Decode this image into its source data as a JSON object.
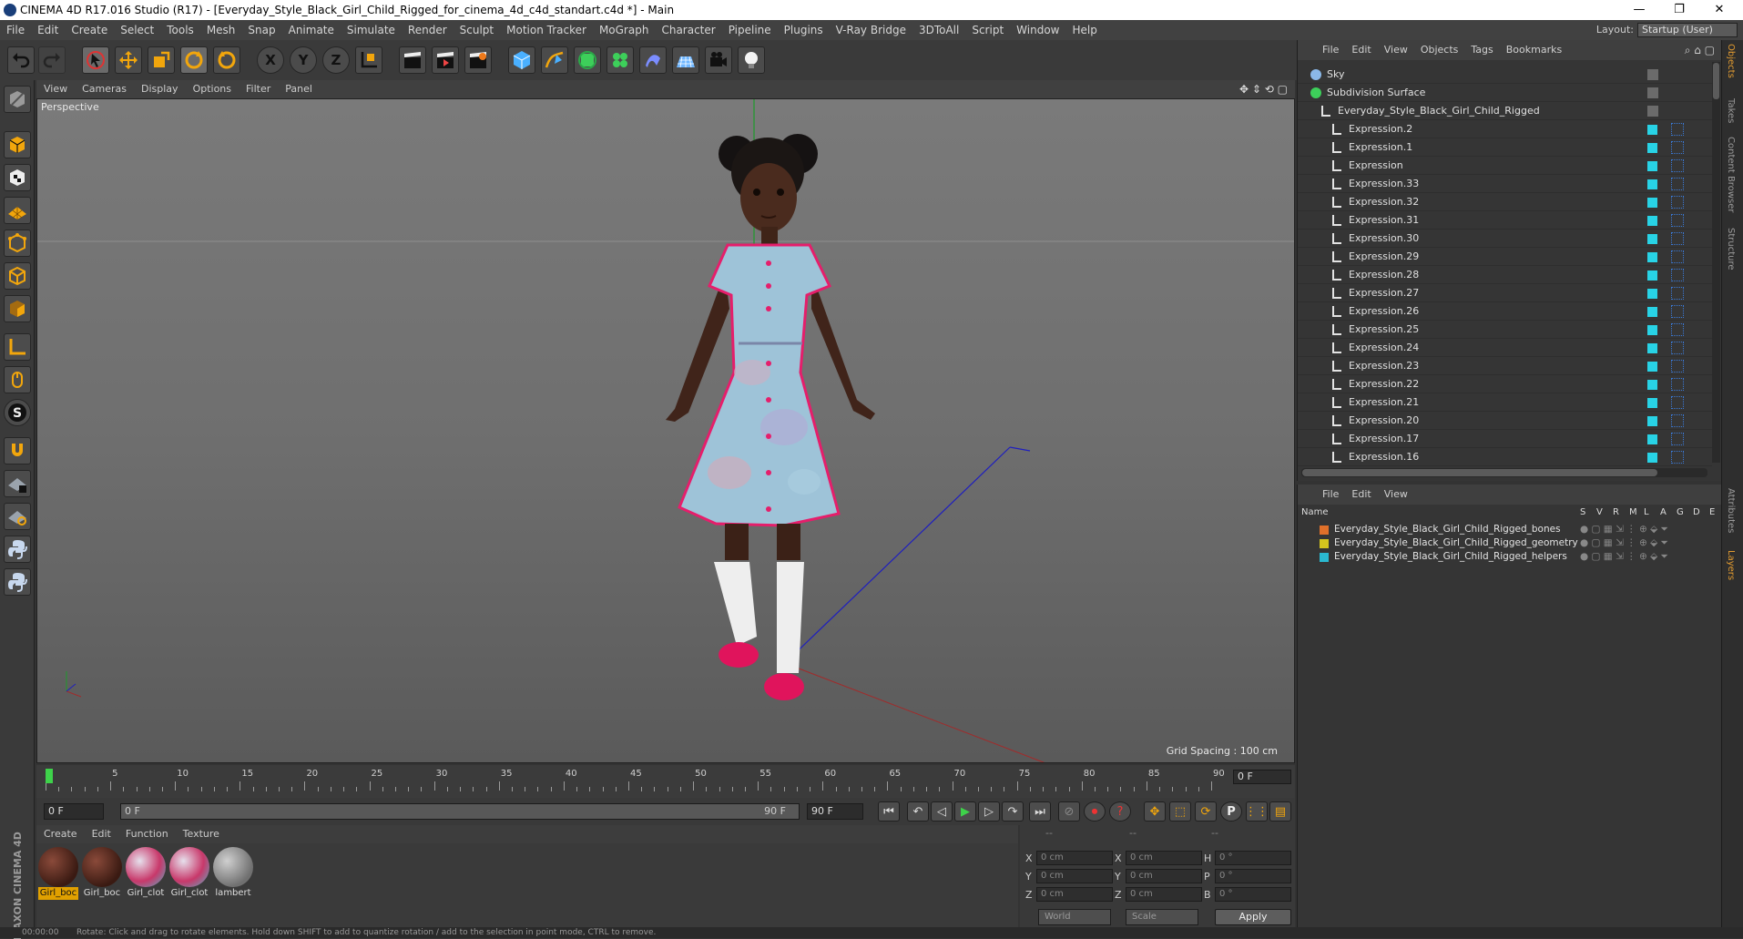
{
  "window": {
    "title": "CINEMA 4D R17.016 Studio (R17) - [Everyday_Style_Black_Girl_Child_Rigged_for_cinema_4d_c4d_standart.c4d *] - Main",
    "minimize": "—",
    "maximize": "❐",
    "close": "✕"
  },
  "menubar": {
    "items": [
      "File",
      "Edit",
      "Create",
      "Select",
      "Tools",
      "Mesh",
      "Snap",
      "Animate",
      "Simulate",
      "Render",
      "Sculpt",
      "Motion Tracker",
      "MoGraph",
      "Character",
      "Pipeline",
      "Plugins",
      "V-Ray Bridge",
      "3DToAll",
      "Script",
      "Window",
      "Help"
    ],
    "layout_label": "Layout:",
    "layout_value": "Startup (User)"
  },
  "toolbar": {
    "x_label": "X",
    "y_label": "Y",
    "z_label": "Z"
  },
  "viewport": {
    "menu": [
      "View",
      "Cameras",
      "Display",
      "Options",
      "Filter",
      "Panel"
    ],
    "label": "Perspective",
    "grid_spacing": "Grid Spacing : 100 cm"
  },
  "timeline": {
    "ticks": [
      "0",
      "5",
      "10",
      "15",
      "20",
      "25",
      "30",
      "35",
      "40",
      "45",
      "50",
      "55",
      "60",
      "65",
      "70",
      "75",
      "80",
      "85",
      "90"
    ],
    "current_frame": "0 F",
    "start_frame": "0 F",
    "range_start": "0 F",
    "range_end": "90 F",
    "end_frame": "90 F"
  },
  "materials": {
    "menu": [
      "Create",
      "Edit",
      "Function",
      "Texture"
    ],
    "items": [
      {
        "label": "Girl_boc",
        "selected": true
      },
      {
        "label": "Girl_boc",
        "selected": false
      },
      {
        "label": "Girl_clot",
        "selected": false
      },
      {
        "label": "Girl_clot",
        "selected": false
      },
      {
        "label": "lambert",
        "selected": false
      }
    ],
    "brand_text": "MAXON CINEMA 4D"
  },
  "coords": {
    "header1": "--",
    "header2": "--",
    "header3": "--",
    "x_label": "X",
    "y_label": "Y",
    "z_label": "Z",
    "x2_label": "X",
    "y2_label": "Y",
    "z2_label": "Z",
    "h_label": "H",
    "p_label": "P",
    "b_label": "B",
    "x_val": "0 cm",
    "y_val": "0 cm",
    "z_val": "0 cm",
    "x2_val": "0 cm",
    "y2_val": "0 cm",
    "z2_val": "0 cm",
    "h_val": "0 °",
    "p_val": "0 °",
    "b_val": "0 °",
    "mode1": "World",
    "mode2": "Scale",
    "apply": "Apply"
  },
  "objects": {
    "menu": [
      "File",
      "Edit",
      "View",
      "Objects",
      "Tags",
      "Bookmarks"
    ],
    "rows": [
      {
        "name": "Sky"
      },
      {
        "name": "Subdivision Surface"
      },
      {
        "name": "Everyday_Style_Black_Girl_Child_Rigged"
      },
      {
        "name": "Expression.2"
      },
      {
        "name": "Expression.1"
      },
      {
        "name": "Expression"
      },
      {
        "name": "Expression.33"
      },
      {
        "name": "Expression.32"
      },
      {
        "name": "Expression.31"
      },
      {
        "name": "Expression.30"
      },
      {
        "name": "Expression.29"
      },
      {
        "name": "Expression.28"
      },
      {
        "name": "Expression.27"
      },
      {
        "name": "Expression.26"
      },
      {
        "name": "Expression.25"
      },
      {
        "name": "Expression.24"
      },
      {
        "name": "Expression.23"
      },
      {
        "name": "Expression.22"
      },
      {
        "name": "Expression.21"
      },
      {
        "name": "Expression.20"
      },
      {
        "name": "Expression.17"
      },
      {
        "name": "Expression.16"
      }
    ]
  },
  "layers": {
    "menu": [
      "File",
      "Edit",
      "View"
    ],
    "header_name": "Name",
    "header_cols": [
      "S",
      "V",
      "R",
      "M",
      "L",
      "A",
      "G",
      "D",
      "E"
    ],
    "rows": [
      {
        "name": "Everyday_Style_Black_Girl_Child_Rigged_bones",
        "color": "#e0702a"
      },
      {
        "name": "Everyday_Style_Black_Girl_Child_Rigged_geometry",
        "color": "#d4c41e"
      },
      {
        "name": "Everyday_Style_Black_Girl_Child_Rigged_helpers",
        "color": "#2ab8d0"
      }
    ]
  },
  "side_tabs": [
    "Objects",
    "Takes",
    "Content Browser",
    "Structure",
    "Attributes",
    "Layers"
  ],
  "status": {
    "time": "00:00:00",
    "text": "Rotate: Click and drag to rotate elements. Hold down SHIFT to add to quantize rotation / add to the selection in point mode, CTRL to remove."
  }
}
